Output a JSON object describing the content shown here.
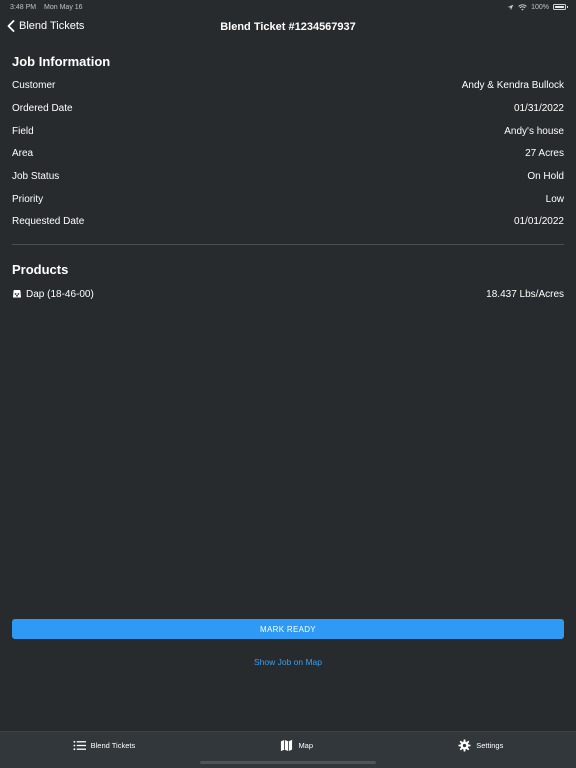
{
  "status": {
    "time": "3:48 PM",
    "date": "Mon May 16",
    "battery": "100%"
  },
  "nav": {
    "back_label": "Blend Tickets",
    "title": "Blend Ticket #1234567937"
  },
  "job_info": {
    "heading": "Job Information",
    "rows": [
      {
        "label": "Customer",
        "value": "Andy & Kendra Bullock"
      },
      {
        "label": "Ordered Date",
        "value": "01/31/2022"
      },
      {
        "label": "Field",
        "value": "Andy's house"
      },
      {
        "label": "Area",
        "value": "27 Acres"
      },
      {
        "label": "Job Status",
        "value": "On Hold"
      },
      {
        "label": "Priority",
        "value": "Low"
      },
      {
        "label": "Requested Date",
        "value": "01/01/2022"
      }
    ]
  },
  "products": {
    "heading": "Products",
    "items": [
      {
        "name": "Dap (18-46-00)",
        "rate": "18.437 Lbs/Acres",
        "icon": "fertilizer-bag-icon"
      }
    ]
  },
  "actions": {
    "mark_ready": "MARK READY",
    "show_map": "Show Job on Map"
  },
  "tabs": [
    {
      "label": "Blend Tickets",
      "icon": "list-icon"
    },
    {
      "label": "Map",
      "icon": "map-icon"
    },
    {
      "label": "Settings",
      "icon": "gear-icon"
    }
  ],
  "colors": {
    "background": "#272b2e",
    "accent": "#2f9af5",
    "tab_bar": "#32373b"
  }
}
